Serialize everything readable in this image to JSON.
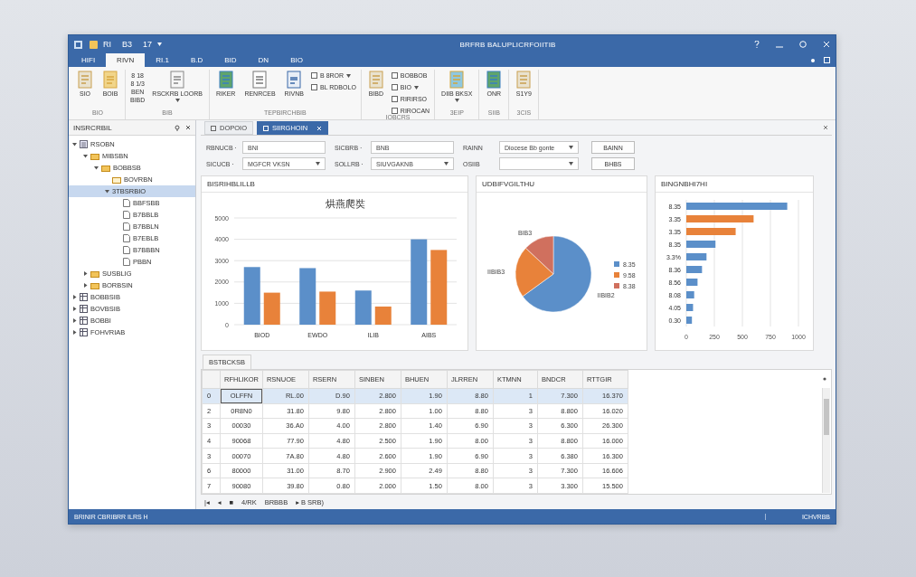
{
  "window": {
    "quick_access": [
      "RI",
      "B3",
      "17"
    ],
    "title": "BRFRB BALUPLICRFOIITIB"
  },
  "ribbon": {
    "tabs": [
      {
        "label": "HIFI",
        "selected": false
      },
      {
        "label": "RIVN",
        "selected": true
      },
      {
        "label": "RI.1",
        "selected": false
      },
      {
        "label": "B.D",
        "selected": false
      },
      {
        "label": "BID",
        "selected": false
      },
      {
        "label": "DN",
        "selected": false
      },
      {
        "label": "BIO",
        "selected": false
      }
    ],
    "groups": [
      {
        "label": "BIO",
        "items": [
          {
            "kind": "large",
            "label": "SIO"
          },
          {
            "kind": "large",
            "label": "BOIB"
          }
        ]
      },
      {
        "label": "BIB",
        "items": [
          {
            "kind": "stack",
            "lines": [
              "8 18",
              "8 1/3",
              "BEN",
              "BIBD"
            ]
          },
          {
            "kind": "large",
            "label": "RSCKRB LOORB",
            "dropdown": true
          }
        ]
      },
      {
        "label": "TEPBIRCHBIB",
        "items": [
          {
            "kind": "large",
            "label": "RIKER"
          },
          {
            "kind": "large",
            "label": "RENRCEB"
          },
          {
            "kind": "large",
            "label": "RIVNB"
          },
          {
            "kind": "small",
            "label": "B 8ROR",
            "dropdown": true
          },
          {
            "kind": "small",
            "label": "BL RDBOLO"
          }
        ]
      },
      {
        "label": "IOBCRS",
        "items": [
          {
            "kind": "large",
            "label": "BIBD"
          },
          {
            "kind": "small",
            "label": "BOBBOB"
          },
          {
            "kind": "small",
            "label": "BIO",
            "dropdown": true
          },
          {
            "kind": "small",
            "label": "RIRIRSO"
          },
          {
            "kind": "small",
            "label": "RIROCAN"
          }
        ]
      },
      {
        "label": "3EIP",
        "items": [
          {
            "kind": "large",
            "label": "DIIB BKSX",
            "dropdown": true
          }
        ]
      },
      {
        "label": "SIIB",
        "items": [
          {
            "kind": "large",
            "label": "ONR"
          }
        ]
      },
      {
        "label": "3CIS",
        "items": [
          {
            "kind": "large",
            "label": "S1Y9"
          }
        ]
      }
    ]
  },
  "sidebar": {
    "title": "INSRCRBIL",
    "tree": [
      {
        "label": "RSOBN",
        "kind": "db",
        "expanded": true,
        "selected": false,
        "children": [
          {
            "label": "MIBSBN",
            "kind": "folder",
            "expanded": true,
            "selected": false,
            "children": [
              {
                "label": "BOBBSB",
                "kind": "folder",
                "expanded": true,
                "selected": false,
                "children": [
                  {
                    "label": "BOVRBN",
                    "kind": "page",
                    "selected": false
                  },
                  {
                    "label": "3TBSRBIO",
                    "kind": "none",
                    "expanded": true,
                    "selected": true,
                    "children": [
                      {
                        "label": "BBFSBB",
                        "kind": "doc",
                        "selected": false
                      },
                      {
                        "label": "B7BBLB",
                        "kind": "doc",
                        "selected": false
                      },
                      {
                        "label": "B7BBLN",
                        "kind": "doc",
                        "selected": false
                      },
                      {
                        "label": "B7EBLB",
                        "kind": "doc",
                        "selected": false
                      },
                      {
                        "label": "B7BBBN",
                        "kind": "doc",
                        "selected": false
                      },
                      {
                        "label": "PBBN",
                        "kind": "doc",
                        "selected": false
                      }
                    ]
                  }
                ]
              }
            ]
          },
          {
            "label": "SUSBLIG",
            "kind": "folder",
            "expanded": false,
            "selected": false
          },
          {
            "label": "BORBSIN",
            "kind": "folder",
            "expanded": false,
            "selected": false
          }
        ]
      },
      {
        "label": "BOBBSIB",
        "kind": "table",
        "expanded": false,
        "selected": false
      },
      {
        "label": "BOVBSIB",
        "kind": "table",
        "expanded": false,
        "selected": false
      },
      {
        "label": "BOBBI",
        "kind": "table",
        "expanded": false,
        "selected": false
      },
      {
        "label": "FOHVRIAB",
        "kind": "table",
        "expanded": false,
        "selected": false
      }
    ]
  },
  "document_tabs": [
    {
      "label": "DOPOIO",
      "selected": false
    },
    {
      "label": "SIIRGHOIN",
      "selected": true
    }
  ],
  "filters": {
    "rows": [
      {
        "fields": [
          {
            "kind": "input",
            "label": "RBNUCB ·",
            "value": "BNI"
          },
          {
            "kind": "input",
            "label": "SICBRB ·",
            "value": "BNB"
          },
          {
            "kind": "select",
            "label": "RAINN",
            "value": "Diocese Bb gonte"
          }
        ],
        "button": "BAINN"
      },
      {
        "fields": [
          {
            "kind": "select",
            "label": "SICUCB ·",
            "value": "MGFCR VKSN"
          },
          {
            "kind": "select",
            "label": "SOLLRB ·",
            "value": "SIUVGAKNB"
          },
          {
            "kind": "select",
            "label": "OSIIB"
          }
        ],
        "button": "BHBS"
      }
    ]
  },
  "panels": [
    {
      "title": "BISRIHBLILLB",
      "chart_data": {
        "type": "bar",
        "title": "烘燕爬奘",
        "categories": [
          "BIOD",
          "EWDO",
          "ILIB",
          "AIBS"
        ],
        "series": [
          {
            "color": "#5b8fc9",
            "values": [
              2700,
              2650,
              1600,
              4000
            ]
          },
          {
            "color": "#e8823a",
            "values": [
              1500,
              1550,
              850,
              3500
            ]
          }
        ],
        "ylim": [
          0,
          5000
        ],
        "yticks": [
          0,
          1000,
          2000,
          3000,
          4000,
          5000
        ],
        "grid": true
      }
    },
    {
      "title": "UDBIFVGILTHU",
      "chart_data": {
        "type": "pie",
        "categories": [
          "8.35",
          "9.58",
          "8.38"
        ],
        "values": [
          65,
          22,
          13
        ],
        "colors": [
          "#5b8fc9",
          "#e8823a",
          "#d0705e"
        ],
        "value_labels": [
          "IIBIB2",
          "IIBIB3",
          "BIB3"
        ],
        "legend": true
      }
    },
    {
      "title": "BINGNBHI7HI",
      "chart_data": {
        "type": "bar",
        "orientation": "horizontal",
        "categories": [
          "8.35",
          "3.35",
          "3.35",
          "8.35",
          "3.3%",
          "8.36",
          "8.56",
          "8.08",
          "4.05",
          "0.30"
        ],
        "series": [
          {
            "color": "#5b8fc9",
            "values": [
              900,
              null,
              null,
              260,
              180,
              140,
              100,
              70,
              60,
              50
            ]
          },
          {
            "color": "#e8823a",
            "values": [
              null,
              600,
              440,
              null,
              null,
              null,
              null,
              null,
              null,
              null
            ]
          }
        ],
        "xlim": [
          0,
          1000
        ],
        "xticks": [
          0,
          250,
          500,
          750,
          1000
        ],
        "grid": true
      }
    }
  ],
  "table": {
    "tab": "BSTBCKSB",
    "columns": [
      "RFHLIKOR",
      "RSNUOE",
      "RSERN",
      "SINBEN",
      "BHUEN",
      "JLRREN",
      "KTMNN",
      "BNDCR",
      "RTTGIR"
    ],
    "rows": [
      {
        "index": "0",
        "selected": true,
        "cells": [
          "OLFFN",
          "RL.00",
          "D.90",
          "2.800",
          "1.90",
          "8.80",
          "1",
          "7.300",
          "16.370"
        ]
      },
      {
        "index": "2",
        "selected": false,
        "cells": [
          "0R8N0",
          "31.80",
          "9.80",
          "2.800",
          "1.00",
          "8.80",
          "3",
          "8.800",
          "16.020"
        ]
      },
      {
        "index": "3",
        "selected": false,
        "cells": [
          "00030",
          "36.A0",
          "4.00",
          "2.800",
          "1.40",
          "6.90",
          "3",
          "6.300",
          "26.300"
        ]
      },
      {
        "index": "4",
        "selected": false,
        "cells": [
          "90068",
          "77.90",
          "4.80",
          "2.500",
          "1.90",
          "8.00",
          "3",
          "8.800",
          "16.000"
        ]
      },
      {
        "index": "3",
        "selected": false,
        "cells": [
          "00070",
          "7A.80",
          "4.80",
          "2.600",
          "1.90",
          "6.90",
          "3",
          "6.380",
          "16.300"
        ]
      },
      {
        "index": "6",
        "selected": false,
        "cells": [
          "80000",
          "31.00",
          "8.70",
          "2.900",
          "2.49",
          "8.80",
          "3",
          "7.300",
          "16.606"
        ]
      },
      {
        "index": "7",
        "selected": false,
        "cells": [
          "90080",
          "39.80",
          "0.80",
          "2.000",
          "1.50",
          "8.00",
          "3",
          "3.300",
          "15.500"
        ]
      }
    ]
  },
  "pager": {
    "first": "|◂",
    "prev": "◂",
    "current": "■",
    "position": "4/RK",
    "label": "BRBBB",
    "next": "▸ B SRB)"
  },
  "status_bar": {
    "left": "BRINIR CBRIBRR ILRS H",
    "right": "ICHVRBB"
  }
}
